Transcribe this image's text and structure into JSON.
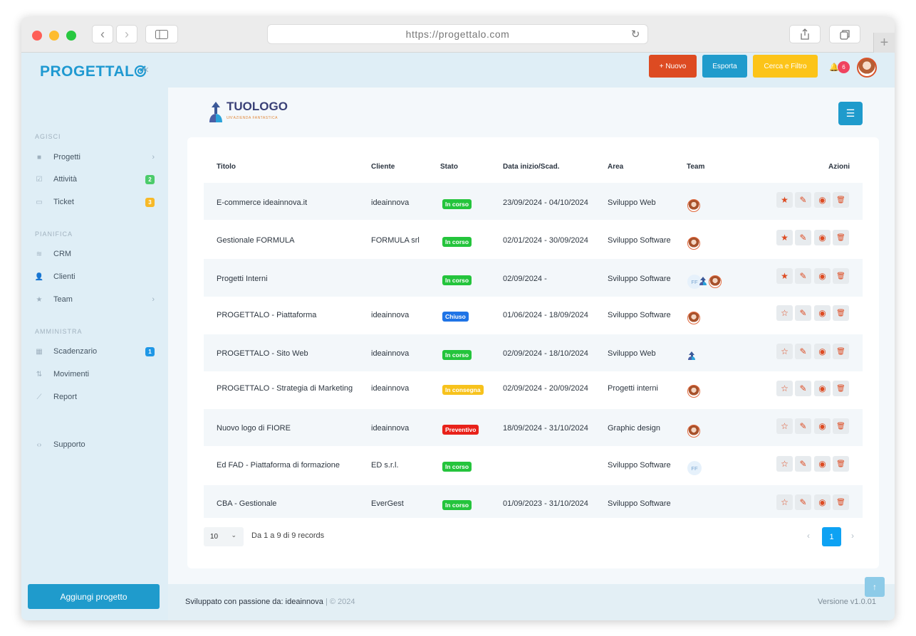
{
  "browser": {
    "url": "https://progettalo.com"
  },
  "sidebar": {
    "logo": "PROGETTAL",
    "sections": [
      {
        "title": "AGISCI",
        "items": [
          {
            "label": "Progetti",
            "icon": "folder-icon",
            "chevron": "›"
          },
          {
            "label": "Attività",
            "icon": "checkbox-icon",
            "badge": "2",
            "badge_color": "#4ccb6b"
          },
          {
            "label": "Ticket",
            "icon": "ticket-icon",
            "badge": "3",
            "badge_color": "#f7b928"
          }
        ]
      },
      {
        "title": "PIANIFICA",
        "items": [
          {
            "label": "CRM",
            "icon": "layers-icon"
          },
          {
            "label": "Clienti",
            "icon": "user-plus-icon"
          },
          {
            "label": "Team",
            "icon": "star-icon",
            "chevron": "›"
          }
        ]
      },
      {
        "title": "AMMINISTRA",
        "items": [
          {
            "label": "Scadenzario",
            "icon": "calendar-icon",
            "badge": "1",
            "badge_color": "#1f97e6"
          },
          {
            "label": "Movimenti",
            "icon": "arrows-icon"
          },
          {
            "label": "Report",
            "icon": "chart-icon"
          }
        ]
      }
    ],
    "support": "Supporto",
    "add_project": "Aggiungi progetto"
  },
  "topbar": {
    "new_label": "+ Nuovo",
    "export_label": "Esporta",
    "filter_label": "Cerca e Filtro",
    "notifications": "6"
  },
  "brand": {
    "name": "TUOLOGO",
    "tagline": "UN'AZIENDA FANTASTICA"
  },
  "table": {
    "headers": {
      "title": "Titolo",
      "client": "Cliente",
      "status": "Stato",
      "dates": "Data inizio/Scad.",
      "area": "Area",
      "team": "Team",
      "actions": "Azioni"
    },
    "rows": [
      {
        "title": "E-commerce ideainnova.it",
        "client": "ideainnova",
        "status": "In corso",
        "status_color": "#24c43c",
        "dates": "23/09/2024 - 04/10/2024",
        "area": "Sviluppo Web",
        "team": [
          "avatar"
        ],
        "favorite": true
      },
      {
        "title": "Gestionale FORMULA",
        "client": "FORMULA srl",
        "status": "In corso",
        "status_color": "#24c43c",
        "dates": "02/01/2024 - 30/09/2024",
        "area": "Sviluppo Software",
        "team": [
          "avatar"
        ],
        "favorite": true
      },
      {
        "title": "Progetti Interni",
        "client": "",
        "status": "In corso",
        "status_color": "#24c43c",
        "dates": "02/09/2024 -",
        "area": "Sviluppo Software",
        "team": [
          "FF",
          "logo",
          "avatar"
        ],
        "favorite": true
      },
      {
        "title": "PROGETTALO - Piattaforma",
        "client": "ideainnova",
        "status": "Chiuso",
        "status_color": "#1f74e6",
        "dates": "01/06/2024 - 18/09/2024",
        "area": "Sviluppo Software",
        "team": [
          "avatar"
        ],
        "favorite": false
      },
      {
        "title": "PROGETTALO - Sito Web",
        "client": "ideainnova",
        "status": "In corso",
        "status_color": "#24c43c",
        "dates": "02/09/2024 - 18/10/2024",
        "area": "Sviluppo Web",
        "team": [
          "logo"
        ],
        "favorite": false
      },
      {
        "title": "PROGETTALO - Strategia di Marketing",
        "client": "ideainnova",
        "status": "In consegna",
        "status_color": "#f7c21c",
        "dates": "02/09/2024 - 20/09/2024",
        "area": "Progetti interni",
        "team": [
          "avatar"
        ],
        "favorite": false
      },
      {
        "title": "Nuovo logo di FIORE",
        "client": "ideainnova",
        "status": "Preventivo",
        "status_color": "#e8221a",
        "dates": "18/09/2024 - 31/10/2024",
        "area": "Graphic design",
        "team": [
          "avatar"
        ],
        "favorite": false
      },
      {
        "title": "Ed FAD - Piattaforma di formazione",
        "client": "ED s.r.l.",
        "status": "In corso",
        "status_color": "#24c43c",
        "dates": "",
        "area": "Sviluppo Software",
        "team": [
          "FF"
        ],
        "favorite": false
      },
      {
        "title": "CBA - Gestionale",
        "client": "EverGest",
        "status": "In corso",
        "status_color": "#24c43c",
        "dates": "01/09/2023 - 31/10/2024",
        "area": "Sviluppo Software",
        "team": [],
        "favorite": false
      }
    ]
  },
  "pager": {
    "page_size": "10",
    "records_text": "Da 1 a 9 di 9 records",
    "current_page": "1"
  },
  "footer": {
    "made_with": "Sviluppato con passione da:",
    "company": "ideainnova",
    "separator": "|",
    "year": "© 2024",
    "version": "Versione v1.0.01"
  }
}
